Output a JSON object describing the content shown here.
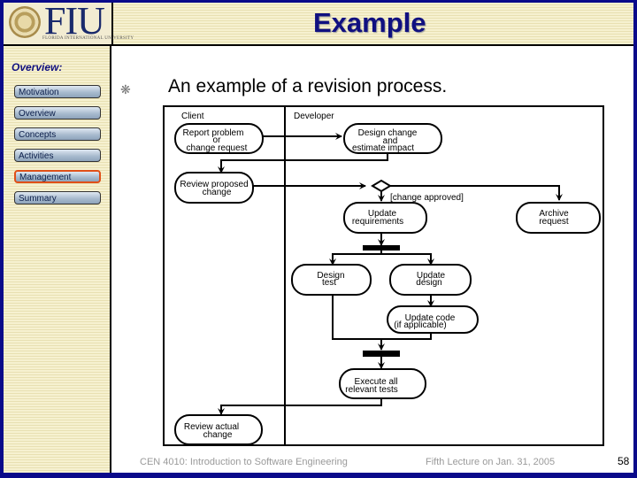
{
  "header": {
    "logo_text": "FIU",
    "logo_subtitle": "FLORIDA INTERNATIONAL UNIVERSITY",
    "title": "Example"
  },
  "sidebar": {
    "heading": "Overview:",
    "items": [
      {
        "label": "Motivation",
        "active": false
      },
      {
        "label": "Overview",
        "active": false
      },
      {
        "label": "Concepts",
        "active": false
      },
      {
        "label": "Activities",
        "active": false
      },
      {
        "label": "Management",
        "active": true
      },
      {
        "label": "Summary",
        "active": false
      }
    ]
  },
  "content": {
    "bullet_icon": "asterisk-bullet",
    "heading": "An example of a revision process."
  },
  "diagram": {
    "swimlanes": [
      "Client",
      "Developer"
    ],
    "activities": {
      "report_problem": [
        "Report problem",
        "or",
        "change request"
      ],
      "design_change": [
        "Design change",
        "and",
        "estimate impact"
      ],
      "review_proposed": [
        "Review proposed",
        "change"
      ],
      "update_requirements": [
        "Update",
        "requirements"
      ],
      "archive_request": [
        "Archive",
        "request"
      ],
      "design_test": [
        "Design",
        "test"
      ],
      "update_design": [
        "Update",
        "design"
      ],
      "update_code": [
        "Update code",
        "(if applicable)"
      ],
      "execute_tests": [
        "Execute all",
        "relevant tests"
      ],
      "review_actual": [
        "Review actual",
        "change"
      ]
    },
    "guard": "[change approved]"
  },
  "footer": {
    "course": "CEN 4010: Introduction to Software Engineering",
    "lecture": "Fifth Lecture on Jan. 31, 2005",
    "page_number": "58"
  }
}
